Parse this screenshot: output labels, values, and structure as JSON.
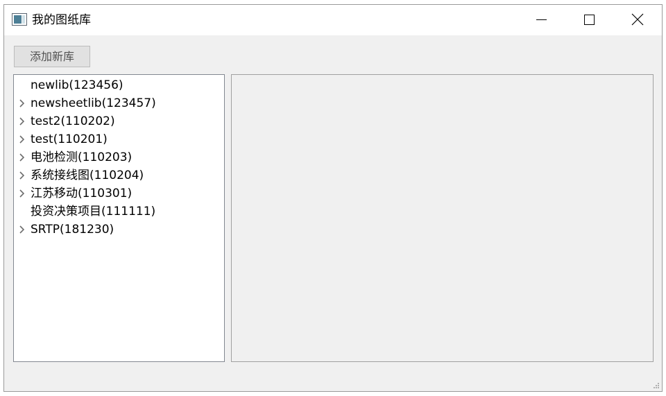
{
  "window": {
    "title": "我的图纸库",
    "icon": "app-window-icon"
  },
  "titlebar_buttons": {
    "minimize_icon": "minimize-icon",
    "maximize_icon": "maximize-icon",
    "close_icon": "close-icon"
  },
  "toolbar": {
    "add_label": "添加新库"
  },
  "tree": {
    "items": [
      {
        "label": "newlib(123456)",
        "expandable": false
      },
      {
        "label": "newsheetlib(123457)",
        "expandable": true
      },
      {
        "label": "test2(110202)",
        "expandable": true
      },
      {
        "label": "test(110201)",
        "expandable": true
      },
      {
        "label": "电池检测(110203)",
        "expandable": true
      },
      {
        "label": "系统接线图(110204)",
        "expandable": true
      },
      {
        "label": "江苏移动(110301)",
        "expandable": true
      },
      {
        "label": "投资决策项目(111111)",
        "expandable": false
      },
      {
        "label": "SRTP(181230)",
        "expandable": true
      }
    ]
  },
  "colors": {
    "titlebar": "#ffffff",
    "window_bg": "#f0f0f0",
    "button_bg": "#e1e1e1",
    "expander": "#6e6e6e"
  }
}
